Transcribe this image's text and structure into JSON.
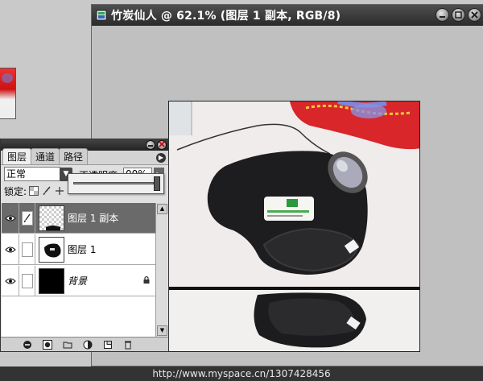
{
  "document": {
    "title": "竹炭仙人 @ 62.1% (图层 1 副本, RGB/8)"
  },
  "layers_panel": {
    "tabs": [
      "图层",
      "通道",
      "路径"
    ],
    "blend_mode": "正常",
    "opacity_label": "不透明度:",
    "opacity_value": "00%",
    "lock_label": "锁定:",
    "layers": [
      {
        "name": "图层 1 副本",
        "selected": true,
        "visible": true,
        "italic": false
      },
      {
        "name": "图层 1",
        "selected": false,
        "visible": true,
        "italic": false
      },
      {
        "name": "背景",
        "selected": false,
        "visible": true,
        "italic": true,
        "locked": true
      }
    ]
  },
  "status_bar": {
    "text": "http://www.myspace.cn/1307428456"
  },
  "colors": {
    "title_bar": "#2b2b2b",
    "selected_layer": "#6a6a6a",
    "workspace": "#c0c0c0"
  },
  "icons": [
    "photoshop-doc-icon",
    "minimize-icon",
    "restore-icon",
    "close-icon",
    "eye-icon",
    "brush-icon",
    "lock-icon",
    "panel-menu-icon"
  ]
}
